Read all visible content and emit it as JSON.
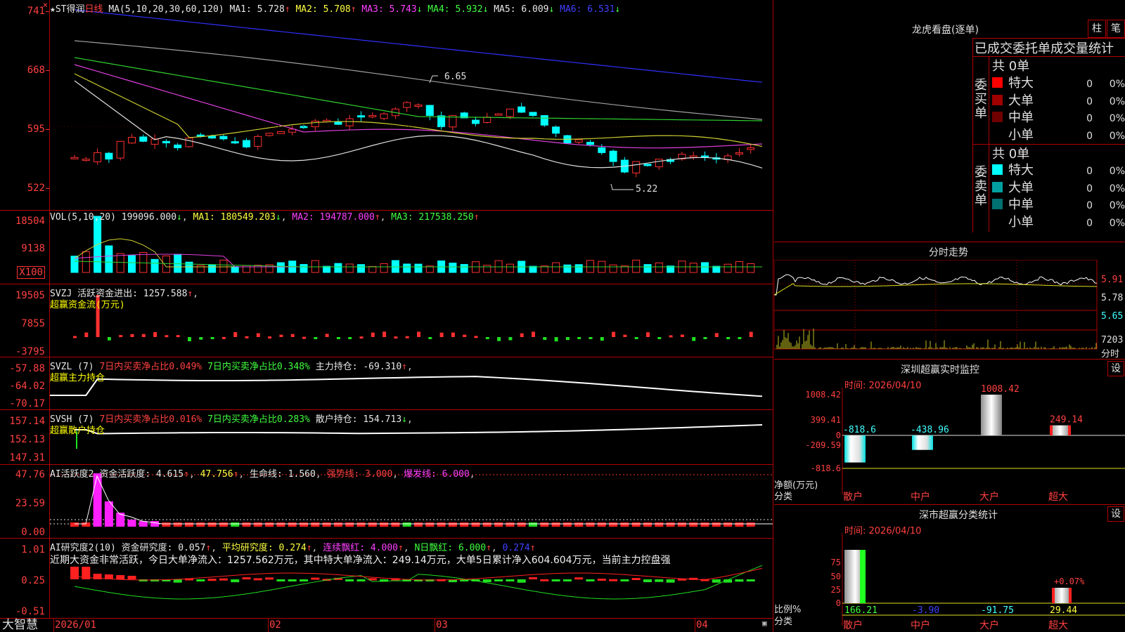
{
  "main": {
    "stock_name": "ST得润",
    "period": "日线",
    "ma_params": "MA(5,10,20,30,60,120)",
    "ma": [
      {
        "label": "MA1:",
        "value": "5.728",
        "arrow": "↑",
        "color": "#e8e8e8"
      },
      {
        "label": "MA2:",
        "value": "5.708",
        "arrow": "↑",
        "color": "#ffff40"
      },
      {
        "label": "MA3:",
        "value": "5.743",
        "arrow": "↓",
        "color": "#ff40ff"
      },
      {
        "label": "MA4:",
        "value": "5.932",
        "arrow": "↓",
        "color": "#40ff40"
      },
      {
        "label": "MA5:",
        "value": "6.009",
        "arrow": "↓",
        "color": "#e8e8e8"
      },
      {
        "label": "MA6:",
        "value": "6.531",
        "arrow": "↓",
        "color": "#4040ff"
      }
    ],
    "y_labels": [
      "741",
      "668",
      "595",
      "522"
    ],
    "high_label": "6.65",
    "low_label": "5.22"
  },
  "vol": {
    "header": "VOL(5,10,20)",
    "value": "199096.000",
    "value_arrow": "↓",
    "ma1": "MA1: 180549.203",
    "ma1_arrow": "↓",
    "ma2": "MA2: 194787.000",
    "ma2_arrow": "↑",
    "ma3": "MA3: 217538.250",
    "ma3_arrow": "↑",
    "y_labels": [
      "18504",
      "9138"
    ],
    "unit": "X100"
  },
  "svzj": {
    "header": "SVZJ  活跃资金进出: 1257.588",
    "arrow": "↑",
    "sub": "超赢资金流(万元)",
    "y_labels": [
      "19505",
      "7855",
      "-3795"
    ]
  },
  "svzl": {
    "name": "SVZL  (7)",
    "a": "7日内买卖净占比0.049%",
    "b": "7日内买卖净占比0.348%",
    "c": "主力持仓: -69.310",
    "arrow": "↑",
    "sub": "超赢主力持仓",
    "y_labels": [
      "-57.88",
      "-64.02",
      "-70.17"
    ]
  },
  "svsh": {
    "name": "SVSH  (7)",
    "a": "7日内买卖净占比0.016%",
    "b": "7日内买卖净占比0.283%",
    "c": "散户持仓: 154.713",
    "arrow": "↓",
    "sub": "超赢散户持仓",
    "y_labels": [
      "157.14",
      "152.13",
      "147.31"
    ]
  },
  "ai1": {
    "name": "AI活跃度2",
    "a": "资金活跃度: 4.615",
    "b": "47.756",
    "c": "生命线: 1.560",
    "d": "强势线: 3.000",
    "e": "爆发线: 6.000",
    "y_labels": [
      "47.76",
      "23.59",
      "0.00"
    ]
  },
  "ai2": {
    "name": "AI研究度2(10)",
    "a": "资金研究度: 0.057",
    "b": "平均研究度: 0.274",
    "c": "连续飘红: 4.000",
    "d": "N日飘红: 6.000",
    "e": "0.274",
    "text": "近期大资金非常活跃，今日大单净流入：1257.562万元，其中特大单净流入：249.14万元，大单5日累计净入604.604万元，当前主力控盘强",
    "y_labels": [
      "1.01",
      "0.25",
      "-0.51"
    ]
  },
  "bottom": {
    "brand": "大智慧",
    "dates": [
      "2026/01",
      "02",
      "03",
      "04"
    ]
  },
  "dragon": {
    "title": "龙虎看盘(逐单)",
    "btn1": "柱",
    "btn2": "笔",
    "header": "已成交委托单成交量统计",
    "buy_label": "委买单",
    "sell_label": "委卖单",
    "buy_total": "共 0单",
    "sell_total": "共 0单",
    "buy_rows": [
      {
        "name": "特大",
        "count": "0",
        "pct": "0%",
        "color": "#ff0000"
      },
      {
        "name": "大单",
        "count": "0",
        "pct": "0%",
        "color": "#a00000"
      },
      {
        "name": "中单",
        "count": "0",
        "pct": "0%",
        "color": "#700000"
      },
      {
        "name": "小单",
        "count": "0",
        "pct": "0%",
        "color": ""
      }
    ],
    "sell_rows": [
      {
        "name": "特大",
        "count": "0",
        "pct": "0%",
        "color": "#00ffff"
      },
      {
        "name": "大单",
        "count": "0",
        "pct": "0%",
        "color": "#00a0a0"
      },
      {
        "name": "中单",
        "count": "0",
        "pct": "0%",
        "color": "#007070"
      },
      {
        "name": "小单",
        "count": "0",
        "pct": "0%",
        "color": ""
      }
    ]
  },
  "intraday": {
    "title": "分时走势",
    "y_labels": [
      "5.91",
      "5.78",
      "5.65",
      "7203"
    ],
    "x_label": "分时"
  },
  "monitor": {
    "title": "深圳超赢实时监控",
    "setting": "设",
    "time": "时间: 2026/04/10",
    "y_labels": [
      "1008.42",
      "399.41",
      "0",
      "-209.59",
      "-818.6"
    ],
    "side_label1": "净额(万元)",
    "side_label2": "分类",
    "categories": [
      "散户",
      "中户",
      "大户",
      "超大"
    ],
    "values": [
      -818.6,
      -438.96,
      1008.42,
      249.14
    ],
    "value_labels": [
      "-818.6",
      "-438.96",
      "1008.42",
      "249.14"
    ]
  },
  "classify": {
    "title": "深市超赢分类统计",
    "setting": "设",
    "time": "时间: 2026/04/10",
    "y_labels": [
      "75",
      "50",
      "25",
      "0"
    ],
    "side_label1": "比例%",
    "side_label2": "分类",
    "categories": [
      "散户",
      "中户",
      "大户",
      "超大"
    ],
    "value_labels": [
      "166.21",
      "-3.90",
      "-91.75",
      "29.44"
    ],
    "pct_label": "+0.07%"
  }
}
